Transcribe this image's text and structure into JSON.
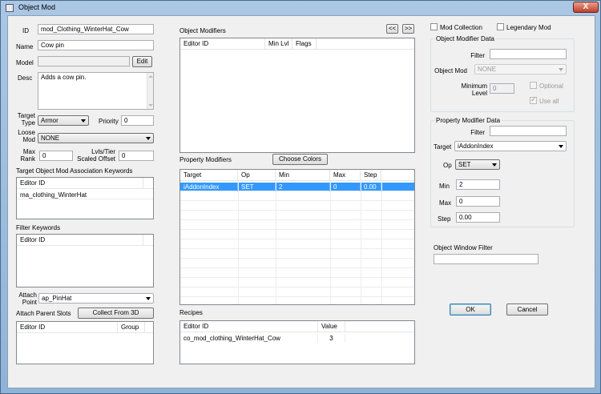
{
  "window": {
    "title": "Object Mod",
    "close_label": "X"
  },
  "left": {
    "id_label": "ID",
    "id_value": "mod_Clothing_WinterHat_Cow",
    "name_label": "Name",
    "name_value": "Cow pin",
    "model_label": "Model",
    "model_value": "",
    "edit_label": "Edit",
    "desc_label": "Desc",
    "desc_value": "Adds a cow pin.",
    "target_type_label_1": "Target",
    "target_type_label_2": "Type",
    "target_type_value": "Armor",
    "priority_label": "Priority",
    "priority_value": "0",
    "loose_mod_label_1": "Loose",
    "loose_mod_label_2": "Mod",
    "loose_mod_value": "NONE",
    "max_rank_label_1": "Max",
    "max_rank_label_2": "Rank",
    "max_rank_value": "0",
    "lvls_label_1": "Lvls/Tier",
    "lvls_label_2": "Scaled Offset",
    "lvls_value": "0",
    "target_kw_label": "Target Object Mod Association Keywords",
    "target_kw_header": "Editor ID",
    "target_kw_rows": [
      "ma_clothing_WinterHat"
    ],
    "filter_kw_label": "Filter Keywords",
    "filter_kw_header": "Editor ID",
    "attach_point_label_1": "Attach",
    "attach_point_label_2": "Point",
    "attach_point_value": "ap_PinHat",
    "attach_parent_label": "Attach Parent Slots",
    "collect_label": "Collect From 3D",
    "slots_headers": [
      "Editor ID",
      "Group"
    ]
  },
  "middle": {
    "obj_mod_label": "Object Modifiers",
    "prev_label": "<<",
    "next_label": ">>",
    "obj_mod_headers": [
      "Editor ID",
      "Min Lvl",
      "Flags"
    ],
    "prop_mod_label": "Property Modifiers",
    "choose_colors_label": "Choose Colors",
    "prop_headers": [
      "Target",
      "Op",
      "Min",
      "Max",
      "Step"
    ],
    "prop_rows": [
      {
        "target": "iAddonIndex",
        "op": "SET",
        "min": "2",
        "max": "0",
        "step": "0.00"
      }
    ],
    "recipes_label": "Recipes",
    "recipes_headers": [
      "Editor ID",
      "Value"
    ],
    "recipes_rows": [
      {
        "id": "co_mod_clothing_WinterHat_Cow",
        "value": "3"
      }
    ]
  },
  "right": {
    "mod_collection_label": "Mod Collection",
    "legendary_label": "Legendary Mod",
    "omd_group_label": "Object Modifier Data",
    "omd_filter_label": "Filter",
    "omd_filter_value": "",
    "object_mod_label": "Object Mod",
    "object_mod_value": "NONE",
    "min_level_label_1": "Minimum",
    "min_level_label_2": "Level",
    "min_level_value": "0",
    "optional_label": "Optional",
    "use_all_label": "Use all",
    "pmd_group_label": "Property Modifier Data",
    "pmd_filter_label": "Filter",
    "pmd_filter_value": "",
    "target_label": "Target",
    "target_value": "iAddonIndex",
    "op_label": "Op",
    "op_value": "SET",
    "min_label": "Min",
    "min_value": "2",
    "max_label": "Max",
    "max_value": "0",
    "step_label": "Step",
    "step_value": "0.00",
    "owf_label": "Object Window Filter",
    "owf_value": "",
    "ok_label": "OK",
    "cancel_label": "Cancel"
  }
}
